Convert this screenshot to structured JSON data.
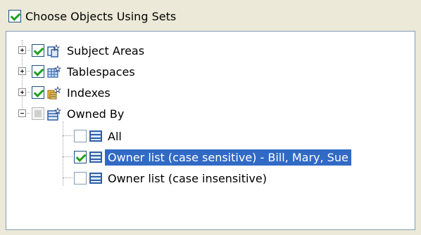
{
  "header": {
    "label": "Choose Objects Using Sets",
    "checked": true
  },
  "tree": {
    "items": [
      {
        "label": "Subject Areas",
        "expanded": false,
        "check": "checked",
        "icon": "subject-areas-icon"
      },
      {
        "label": "Tablespaces",
        "expanded": false,
        "check": "checked",
        "icon": "tablespaces-icon"
      },
      {
        "label": "Indexes",
        "expanded": false,
        "check": "checked",
        "icon": "indexes-icon"
      },
      {
        "label": "Owned By",
        "expanded": true,
        "check": "partial",
        "icon": "owned-by-icon",
        "children": [
          {
            "label": "All",
            "check": "empty",
            "selected": false,
            "icon": "list-icon"
          },
          {
            "label": "Owner list (case sensitive) - Bill, Mary, Sue",
            "check": "checked",
            "selected": true,
            "icon": "list-icon"
          },
          {
            "label": "Owner list (case insensitive)",
            "check": "empty",
            "selected": false,
            "icon": "list-icon"
          }
        ]
      }
    ]
  },
  "colors": {
    "selection": "#316ac5",
    "check": "#21a121",
    "border": "#7f9db9"
  }
}
